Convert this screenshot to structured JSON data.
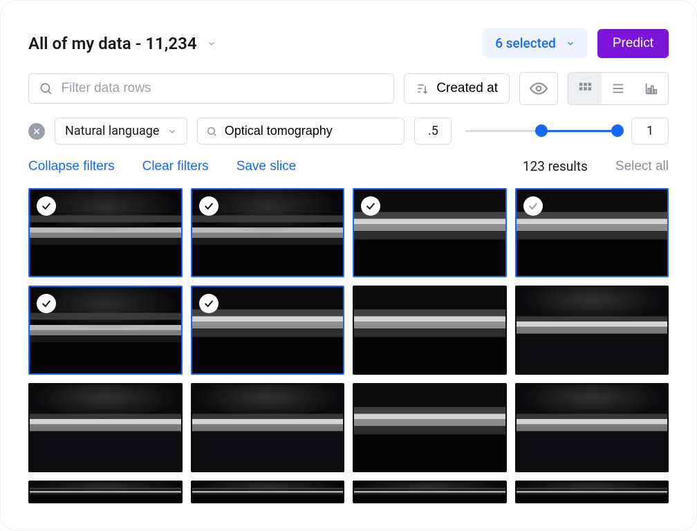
{
  "header": {
    "title": "All of my data - 11,234",
    "selected_label": "6 selected",
    "predict_label": "Predict"
  },
  "toolbar": {
    "filter_placeholder": "Filter data rows",
    "sort_label": "Created at"
  },
  "filters": {
    "mode_label": "Natural language",
    "query": "Optical tomography",
    "range_min": ".5",
    "range_max": "1",
    "slider_lo_pct": 50,
    "slider_hi_pct": 100
  },
  "links": {
    "collapse": "Collapse filters",
    "clear": "Clear filters",
    "save": "Save slice",
    "results": "123 results",
    "select_all": "Select all"
  },
  "grid": {
    "tiles": [
      {
        "selected": true,
        "check": true,
        "variant": "v1"
      },
      {
        "selected": true,
        "check": true,
        "variant": "v1"
      },
      {
        "selected": true,
        "check": true,
        "variant": "v2"
      },
      {
        "selected": true,
        "check": true,
        "variant": "v2",
        "dim": true
      },
      {
        "selected": true,
        "check": true,
        "variant": "v1"
      },
      {
        "selected": true,
        "check": true,
        "variant": "v2"
      },
      {
        "selected": false,
        "check": false,
        "variant": "v2"
      },
      {
        "selected": false,
        "check": false,
        "variant": "v3"
      },
      {
        "selected": false,
        "check": false,
        "variant": "v3"
      },
      {
        "selected": false,
        "check": false,
        "variant": "v3"
      },
      {
        "selected": false,
        "check": false,
        "variant": "v2"
      },
      {
        "selected": false,
        "check": false,
        "variant": "v3"
      },
      {
        "selected": false,
        "check": false,
        "variant": "v1"
      },
      {
        "selected": false,
        "check": false,
        "variant": "v1"
      },
      {
        "selected": false,
        "check": false,
        "variant": "v1"
      },
      {
        "selected": false,
        "check": false,
        "variant": "v1"
      }
    ]
  }
}
